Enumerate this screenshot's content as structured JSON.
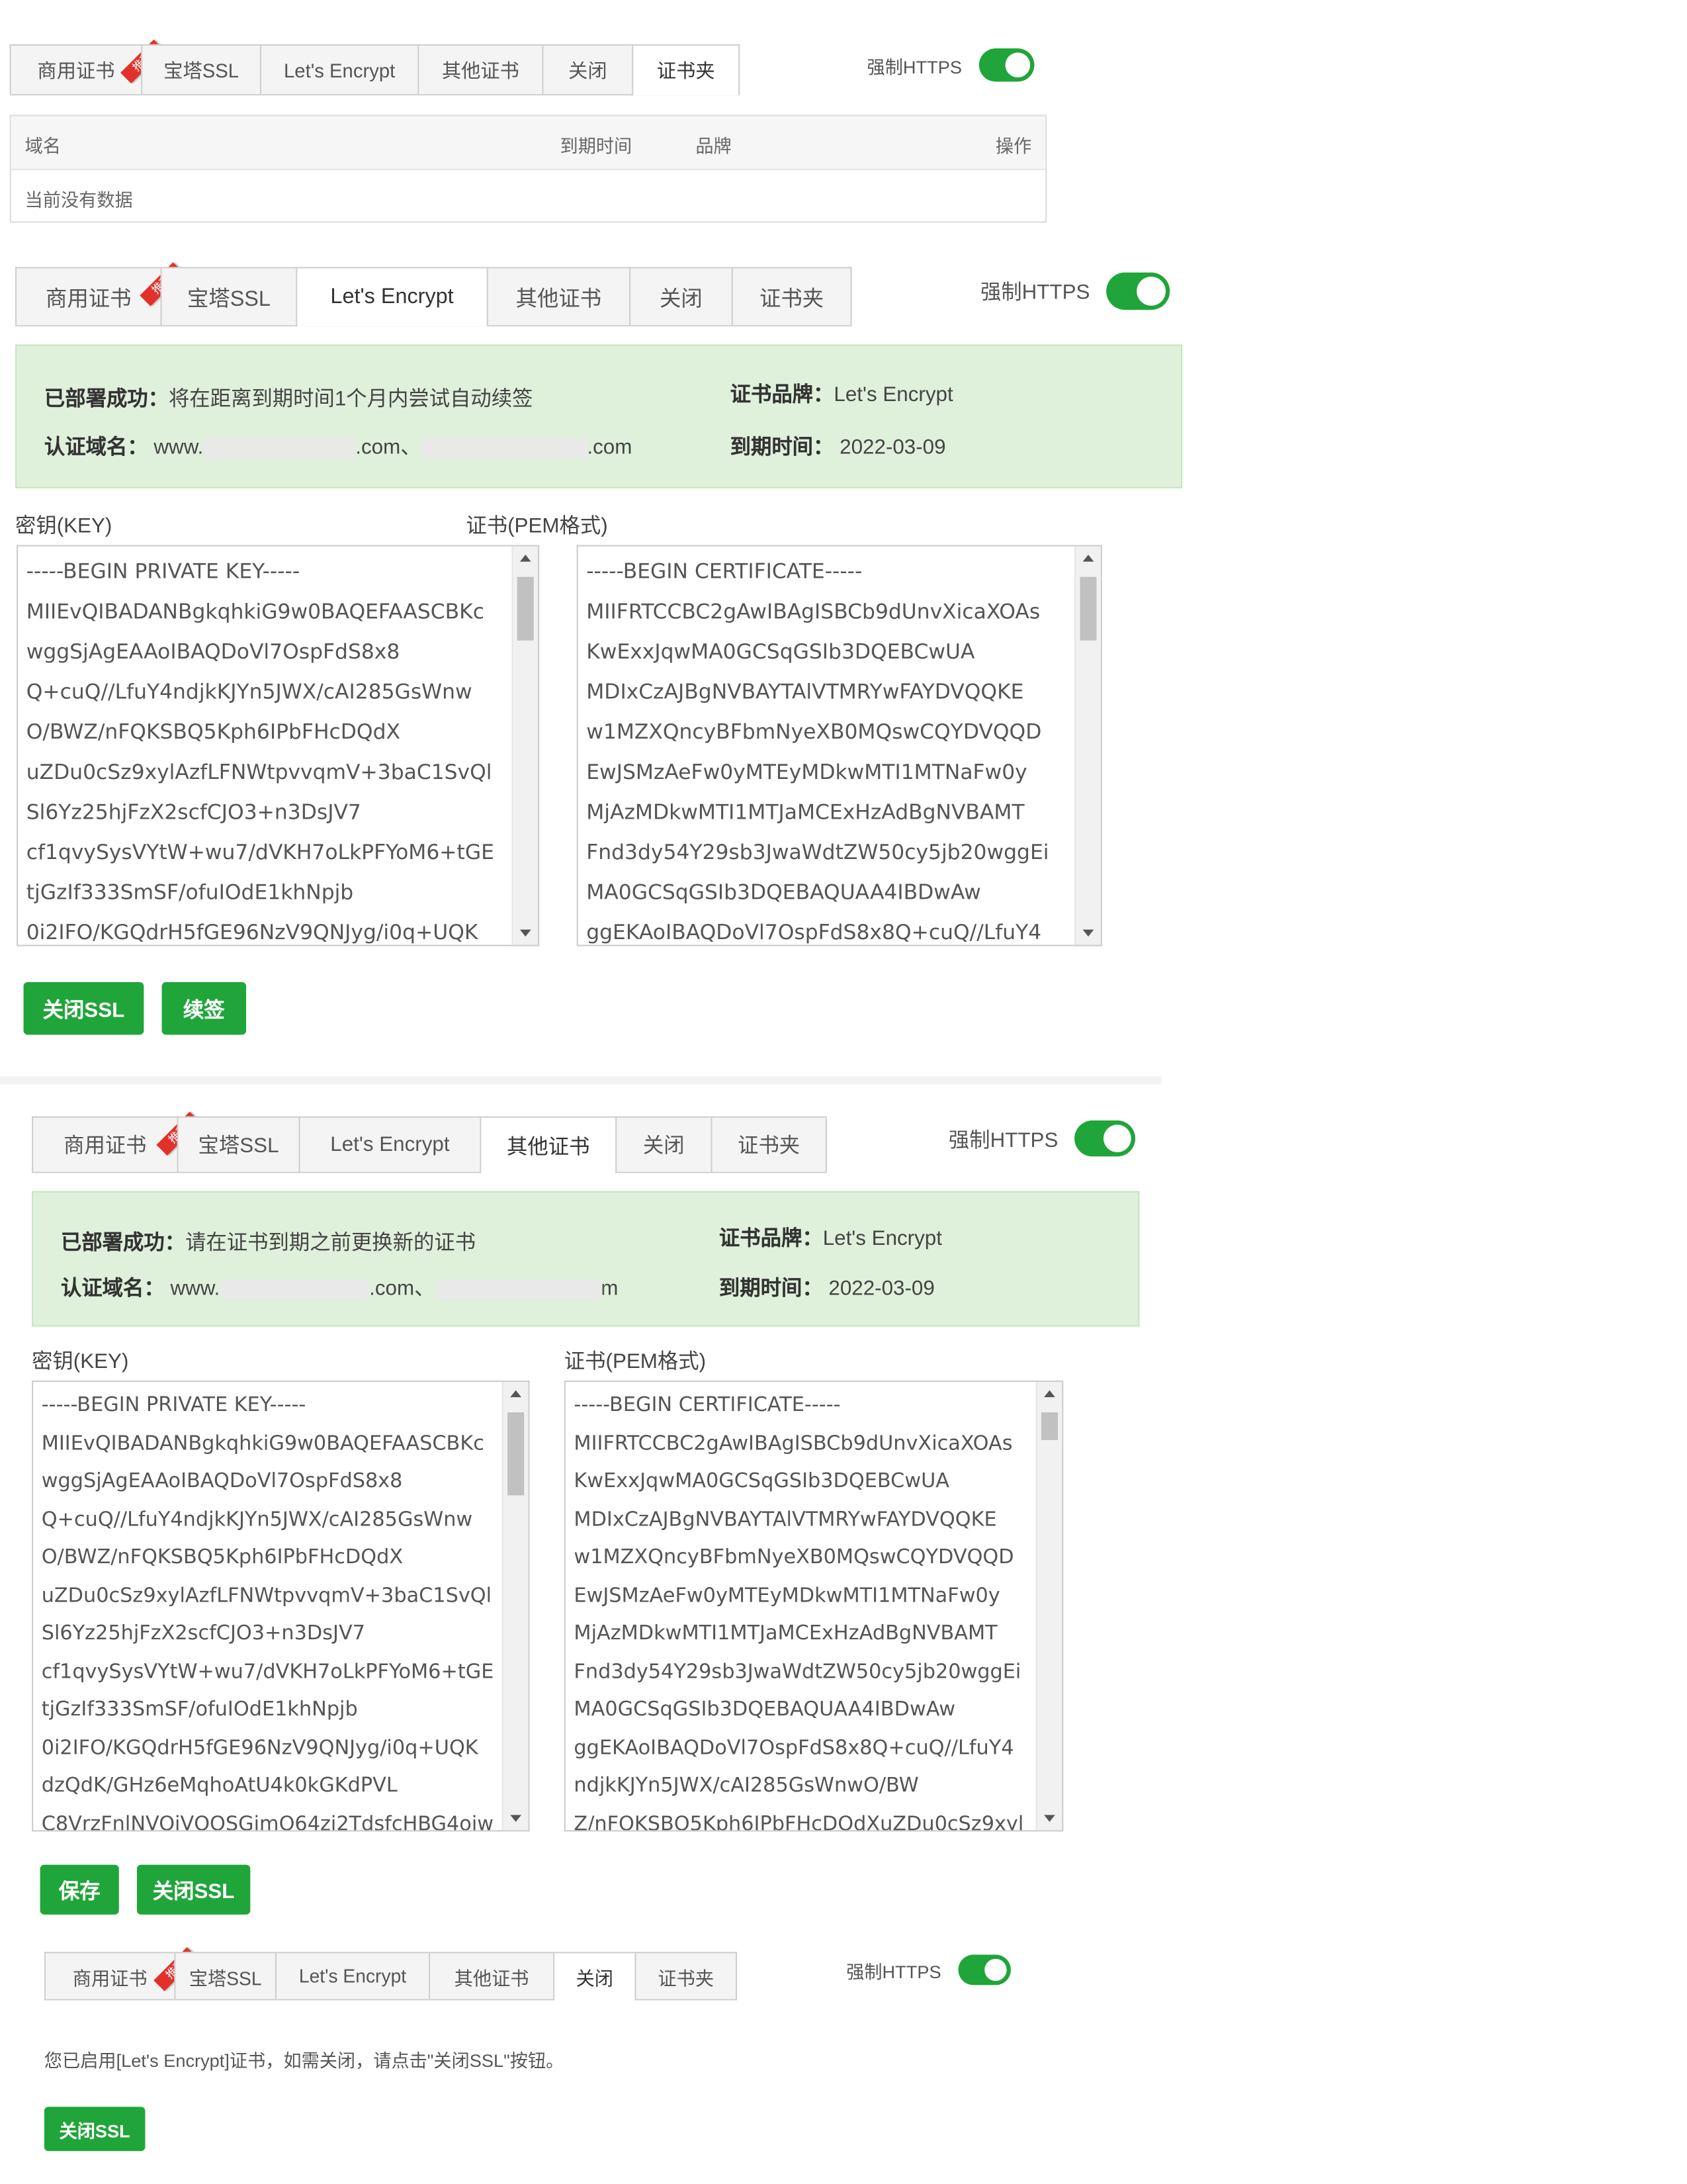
{
  "tabs": [
    "商用证书",
    "宝塔SSL",
    "Let's Encrypt",
    "其他证书",
    "关闭",
    "证书夹"
  ],
  "ribbon_label": "推荐",
  "force_https_label": "强制HTTPS",
  "colors": {
    "accent": "#20a53a",
    "ribbon": "#e2312b",
    "success_bg": "#dff1db"
  },
  "panel1": {
    "active_tab": "证书夹",
    "table": {
      "columns": [
        "域名",
        "到期时间",
        "品牌",
        "操作"
      ],
      "empty_text": "当前没有数据"
    }
  },
  "panel2": {
    "active_tab": "Let's Encrypt",
    "status_label": "已部署成功：",
    "status_text": "将在距离到期时间1个月内尝试自动续签",
    "domains_label": "认证域名：",
    "domain_prefix": "www.",
    "domain_mid": ".com、",
    "domain_suffix": ".com",
    "brand_label": "证书品牌：",
    "brand_value": "Let's Encrypt",
    "expiry_label": "到期时间：",
    "expiry_value": "2022-03-09",
    "key_label": "密钥(KEY)",
    "cert_label": "证书(PEM格式)",
    "buttons": {
      "close_ssl": "关闭SSL",
      "renew": "续签"
    }
  },
  "panel3": {
    "active_tab": "其他证书",
    "status_label": "已部署成功：",
    "status_text": "请在证书到期之前更换新的证书",
    "domains_label": "认证域名：",
    "domain_prefix": "www.",
    "domain_mid": ".com、",
    "domain_suffix": "m",
    "brand_label": "证书品牌：",
    "brand_value": "Let's Encrypt",
    "expiry_label": "到期时间：",
    "expiry_value": "2022-03-09",
    "key_label": "密钥(KEY)",
    "cert_label": "证书(PEM格式)",
    "buttons": {
      "save": "保存",
      "close_ssl": "关闭SSL"
    }
  },
  "panel4": {
    "active_tab": "关闭",
    "message": "您已启用[Let's Encrypt]证书，如需关闭，请点击\"关闭SSL\"按钮。",
    "buttons": {
      "close_ssl": "关闭SSL"
    }
  },
  "key_lines": [
    "-----BEGIN PRIVATE KEY-----",
    "MIIEvQIBADANBgkqhkiG9w0BAQEFAASCBKc",
    "wggSjAgEAAoIBAQDoVl7OspFdS8x8",
    "Q+cuQ//LfuY4ndjkKJYn5JWX/cAI285GsWnw",
    "O/BWZ/nFQKSBQ5Kph6IPbFHcDQdX",
    "uZDu0cSz9xylAzfLFNWtpvvqmV+3baC1SvQl",
    "Sl6Yz25hjFzX2scfCJO3+n3DsJV7",
    "cf1qvySysVYtW+wu7/dVKH7oLkPFYoM6+tGE",
    "tjGzIf333SmSF/ofuIOdE1khNpjb",
    "0i2IFO/KGQdrH5fGE96NzV9QNJyg/i0q+UQK",
    "dzQdK/GHz6eMqhoAtU4k0kGKdPVL",
    "C8VrzFnlNVOiVQOSGimO64zi2TdsfcHBG4oiw"
  ],
  "cert_lines": [
    "-----BEGIN CERTIFICATE-----",
    "MIIFRTCCBC2gAwIBAgISBCb9dUnvXicaXOAs",
    "KwExxJqwMA0GCSqGSIb3DQEBCwUA",
    "MDIxCzAJBgNVBAYTAlVTMRYwFAYDVQQKE",
    "w1MZXQncyBFbmNyeXB0MQswCQYDVQQD",
    "EwJSMzAeFw0yMTEyMDkwMTI1MTNaFw0y",
    "MjAzMDkwMTI1MTJaMCExHzAdBgNVBAMT",
    "Fnd3dy54Y29sb3JwaWdtZW50cy5jb20wggEi",
    "MA0GCSqGSIb3DQEBAQUAA4IBDwAw",
    "ggEKAoIBAQDoVl7OspFdS8x8Q+cuQ//LfuY4",
    "ndjkKJYn5JWX/cAI285GsWnwO/BW",
    "Z/nFQKSBQ5Kph6IPbFHcDQdXuZDu0cSz9xyl"
  ]
}
